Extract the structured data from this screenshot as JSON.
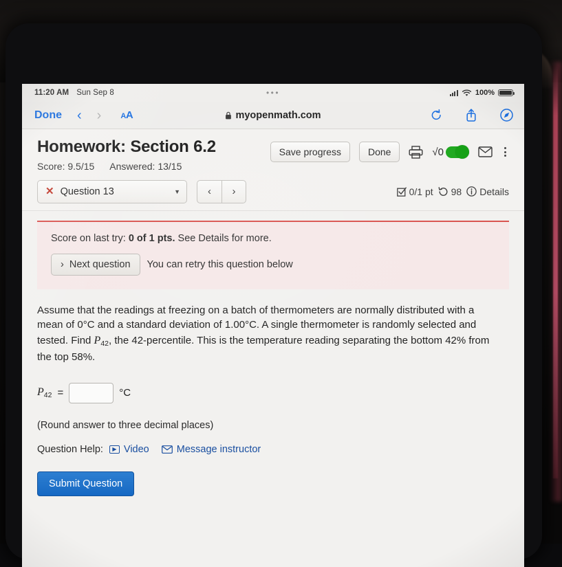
{
  "status_bar": {
    "time": "11:20 AM",
    "date": "Sun Sep 8",
    "dots": "•••",
    "battery_percent": "100%"
  },
  "browser": {
    "done_label": "Done",
    "back_arrow": "‹",
    "forward_arrow": "›",
    "text_size_small": "A",
    "text_size_big": "A",
    "lock": "🔒",
    "url": "myopenmath.com"
  },
  "header": {
    "title": "Homework: Section 6.2",
    "score": "Score: 9.5/15",
    "answered": "Answered: 13/15",
    "save_label": "Save progress",
    "done_label": "Done",
    "sqrt_glyph": "√0"
  },
  "question_bar": {
    "x_mark": "✕",
    "question_label": "Question 13",
    "caret": "▼",
    "prev": "‹",
    "next": "›",
    "points": "0/1 pt",
    "attempts": "98",
    "details_label": "Details"
  },
  "alert": {
    "score_prefix": "Score on last try: ",
    "score_bold": "0 of 1 pts.",
    "score_suffix": " See Details for more.",
    "next_question_label": "Next question",
    "next_question_arrow": "›",
    "retry_note": "You can retry this question below",
    "border_color": "#d9534f",
    "background_color": "#f6e8e8"
  },
  "problem": {
    "line1": "Assume that the readings at freezing on a batch of thermometers are normally distributed",
    "line2_a": "with a mean of 0",
    "line2_b": "C and a standard deviation of 1.00",
    "line2_c": "C. A single thermometer is randomly",
    "line3_a": "selected and tested. Find ",
    "line3_var": "P",
    "line3_sub": "42",
    "line3_b": ", the 42-percentile. This is the temperature reading separating",
    "line4": "the bottom 42% from the top 58%.",
    "degree": "°"
  },
  "answer": {
    "var": "P",
    "sub": "42",
    "equals": "=",
    "value": "",
    "placeholder": "",
    "unit": "°C"
  },
  "footer": {
    "round_note": "(Round answer to three decimal places)",
    "question_help_label": "Question Help:",
    "video_label": "Video",
    "video_glyph": "▶",
    "message_label": "Message instructor",
    "submit_label": "Submit Question",
    "submit_color": "#1668c3"
  }
}
